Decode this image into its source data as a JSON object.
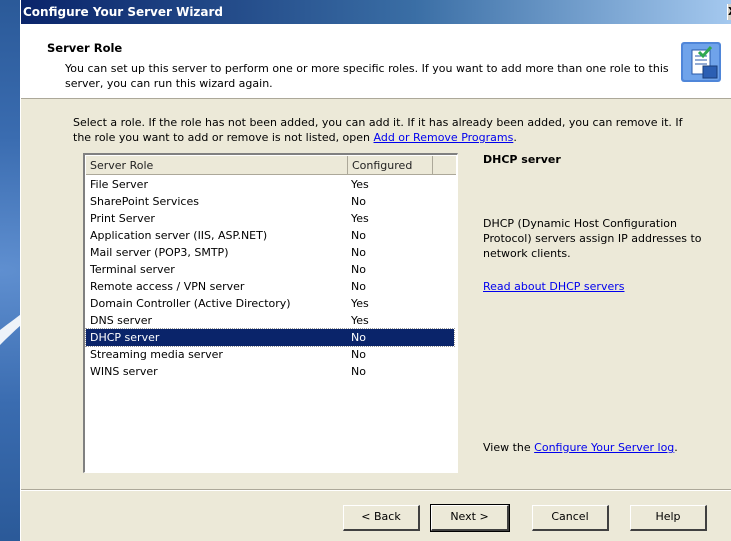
{
  "window": {
    "title": "Configure Your Server Wizard",
    "close_glyph": "X"
  },
  "header": {
    "title": "Server Role",
    "description": "You can set up this server to perform one or more specific roles. If you want to add more than one role to this server, you can run this wizard again."
  },
  "instructions": {
    "text": "Select a role. If the role has not been added, you can add it. If it has already been added, you can remove it. If the role you want to add or remove is not listed, open",
    "link": "Add or Remove Programs",
    "suffix": "."
  },
  "listview": {
    "columns": [
      "Server Role",
      "Configured"
    ],
    "rows": [
      {
        "role": "File Server",
        "configured": "Yes"
      },
      {
        "role": "SharePoint Services",
        "configured": "No"
      },
      {
        "role": "Print Server",
        "configured": "Yes"
      },
      {
        "role": "Application server (IIS, ASP.NET)",
        "configured": "No"
      },
      {
        "role": "Mail server (POP3, SMTP)",
        "configured": "No"
      },
      {
        "role": "Terminal server",
        "configured": "No"
      },
      {
        "role": "Remote access / VPN server",
        "configured": "No"
      },
      {
        "role": "Domain Controller (Active Directory)",
        "configured": "Yes"
      },
      {
        "role": "DNS server",
        "configured": "Yes"
      },
      {
        "role": "DHCP server",
        "configured": "No"
      },
      {
        "role": "Streaming media server",
        "configured": "No"
      },
      {
        "role": "WINS server",
        "configured": "No"
      }
    ],
    "selected_index": 9
  },
  "detail": {
    "title": "DHCP server",
    "description": "DHCP (Dynamic Host Configuration Protocol) servers assign IP addresses to network clients.",
    "read_more_link": "Read about DHCP servers"
  },
  "log": {
    "prefix": "View the",
    "link": "Configure Your Server log",
    "suffix": "."
  },
  "buttons": {
    "back": "< Back",
    "next": "Next >",
    "cancel": "Cancel",
    "help": "Help"
  },
  "colors": {
    "selection": "#0a246a",
    "link": "#0000ee",
    "dialog_bg": "#ece9d8"
  }
}
